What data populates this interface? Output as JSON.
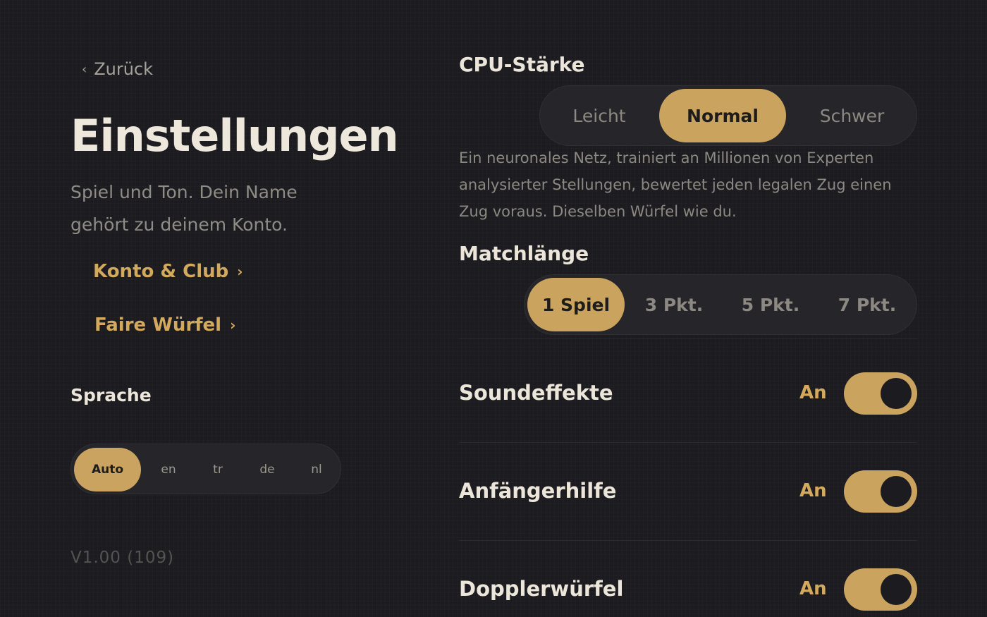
{
  "back_label": "Zurück",
  "title": "Einstellungen",
  "subtitle": "Spiel und Ton. Dein Name gehört zu deinem Konto.",
  "links": [
    {
      "label": "Konto & Club"
    },
    {
      "label": "Faire Würfel"
    }
  ],
  "language": {
    "label": "Sprache",
    "options": [
      "Auto",
      "en",
      "tr",
      "de",
      "nl"
    ],
    "selected": "Auto"
  },
  "version": "V1.00 (109)",
  "cpu": {
    "heading": "CPU-Stärke",
    "options": [
      "Leicht",
      "Normal",
      "Schwer"
    ],
    "selected": "Normal",
    "description": "Ein neuronales Netz, trainiert an Millionen von Experten analysierter Stellungen, bewertet jeden legalen Zug einen Zug voraus. Dieselben Würfel wie du."
  },
  "match": {
    "heading": "Matchlänge",
    "options": [
      "1 Spiel",
      "3 Pkt.",
      "5 Pkt.",
      "7 Pkt."
    ],
    "selected": "1 Spiel"
  },
  "toggles": [
    {
      "label": "Soundeffekte",
      "state": "An",
      "on": true
    },
    {
      "label": "Anfängerhilfe",
      "state": "An",
      "on": true
    },
    {
      "label": "Dopplerwürfel",
      "state": "An",
      "on": true
    }
  ],
  "colors": {
    "background": "#1c1c20",
    "accent": "#caa45f",
    "text": "#ece6da",
    "muted": "#8c8882"
  }
}
